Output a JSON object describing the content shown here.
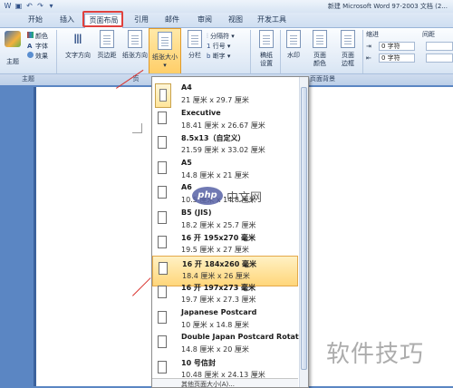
{
  "window": {
    "title": "新建 Microsoft Word 97-2003 文档 (2..."
  },
  "tabs": [
    {
      "label": "开始"
    },
    {
      "label": "插入"
    },
    {
      "label": "页面布局"
    },
    {
      "label": "引用"
    },
    {
      "label": "邮件"
    },
    {
      "label": "审阅"
    },
    {
      "label": "视图"
    },
    {
      "label": "开发工具"
    }
  ],
  "ribbon": {
    "theme": {
      "btn": "主题",
      "colors": "颜色",
      "fonts": "字体",
      "effects": "效果",
      "group": "主题"
    },
    "page_setup": {
      "text_direction": "文字方向",
      "margins": "页边距",
      "orientation": "纸张方向",
      "size": "纸张大小",
      "columns": "分栏",
      "breaks": "分隔符",
      "line_numbers": "行号",
      "hyphenation": "断字",
      "group": "页"
    },
    "draft": "稿纸设置",
    "page_bg": {
      "watermark": "水印",
      "page_color": "页面颜色",
      "page_borders": "页面边框",
      "group": "页面背景"
    },
    "paragraph": {
      "indent": "缩进",
      "spacing": "间距",
      "left_value": "0 字符",
      "right_value": "0 字符"
    }
  },
  "paper_sizes": [
    {
      "name": "A4",
      "dim": "21 厘米 x 29.7 厘米"
    },
    {
      "name": "Executive",
      "dim": "18.41 厘米 x 26.67 厘米"
    },
    {
      "name": "8.5x13（自定义）",
      "dim": "21.59 厘米 x 33.02 厘米"
    },
    {
      "name": "A5",
      "dim": "14.8 厘米 x 21 厘米"
    },
    {
      "name": "A6",
      "dim": "10.5 厘米 x 14.8 厘米"
    },
    {
      "name": "B5 (JIS)",
      "dim": "18.2 厘米 x 25.7 厘米"
    },
    {
      "name": "16 开 195x270 毫米",
      "dim": "19.5 厘米 x 27 厘米"
    },
    {
      "name": "16 开 184x260 毫米",
      "dim": "18.4 厘米 x 26 厘米"
    },
    {
      "name": "16 开 197x273 毫米",
      "dim": "19.7 厘米 x 27.3 厘米"
    },
    {
      "name": "Japanese Postcard",
      "dim": "10 厘米 x 14.8 厘米"
    },
    {
      "name": "Double Japan Postcard Rotated",
      "dim": "14.8 厘米 x 20 厘米"
    },
    {
      "name": "10 号信封",
      "dim": "10.48 厘米 x 24.13 厘米"
    }
  ],
  "dropdown": {
    "more": "其他页面大小(A)...",
    "selected_index": 0,
    "highlighted_index": 7
  },
  "watermarks": {
    "php_badge": "php",
    "php_text": "中文网",
    "site": "软件技巧"
  },
  "colors": {
    "accent": "#d9332e",
    "highlight": "#ffd67a",
    "ribbon": "#dde8f5"
  }
}
